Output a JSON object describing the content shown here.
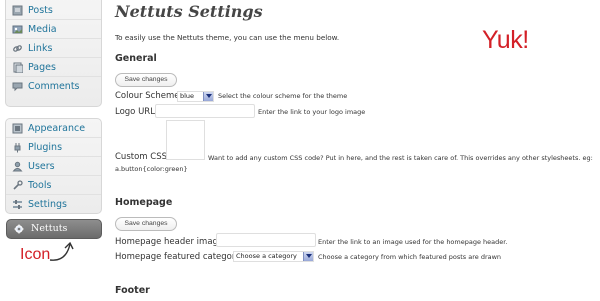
{
  "sidebar": {
    "group1": [
      {
        "label": "Posts",
        "icon": "posts-icon"
      },
      {
        "label": "Media",
        "icon": "media-icon"
      },
      {
        "label": "Links",
        "icon": "links-icon"
      },
      {
        "label": "Pages",
        "icon": "pages-icon"
      },
      {
        "label": "Comments",
        "icon": "comments-icon"
      }
    ],
    "group2": [
      {
        "label": "Appearance",
        "icon": "appearance-icon"
      },
      {
        "label": "Plugins",
        "icon": "plugins-icon"
      },
      {
        "label": "Users",
        "icon": "users-icon"
      },
      {
        "label": "Tools",
        "icon": "tools-icon"
      },
      {
        "label": "Settings",
        "icon": "settings-icon"
      }
    ],
    "active": {
      "label": "Nettuts",
      "icon": "gear-icon"
    }
  },
  "annotations": {
    "icon_note": "Icon",
    "yuk": "Yuk!",
    "color": "#d32027"
  },
  "page": {
    "title": "Nettuts Settings",
    "intro": "To easily use the Nettuts theme, you can use the menu below."
  },
  "general": {
    "heading": "General",
    "save_label": "Save changes",
    "colour_scheme_label": "Colour Scheme",
    "colour_scheme_value": "blue",
    "colour_scheme_help": "Select the colour scheme for the theme",
    "logo_label": "Logo URL",
    "logo_value": "",
    "logo_help": "Enter the link to your logo image",
    "css_label": "Custom CSS",
    "css_value": "",
    "css_help_line1": "Want to add any custom CSS code? Put in here, and the rest is taken care of. This overrides any other stylesheets. eg:",
    "css_help_line2": "a.button{color:green}"
  },
  "homepage": {
    "heading": "Homepage",
    "save_label": "Save changes",
    "header_image_label": "Homepage header image",
    "header_image_value": "",
    "header_image_help": "Enter the link to an image used for the homepage header.",
    "featured_label": "Homepage featured category",
    "featured_value": "Choose a category",
    "featured_help": "Choose a category from which featured posts are drawn"
  },
  "footer": {
    "heading": "Footer"
  },
  "colors": {
    "link": "#21759b",
    "active_menu": "#7b7b7b",
    "annotation": "#d32027"
  }
}
